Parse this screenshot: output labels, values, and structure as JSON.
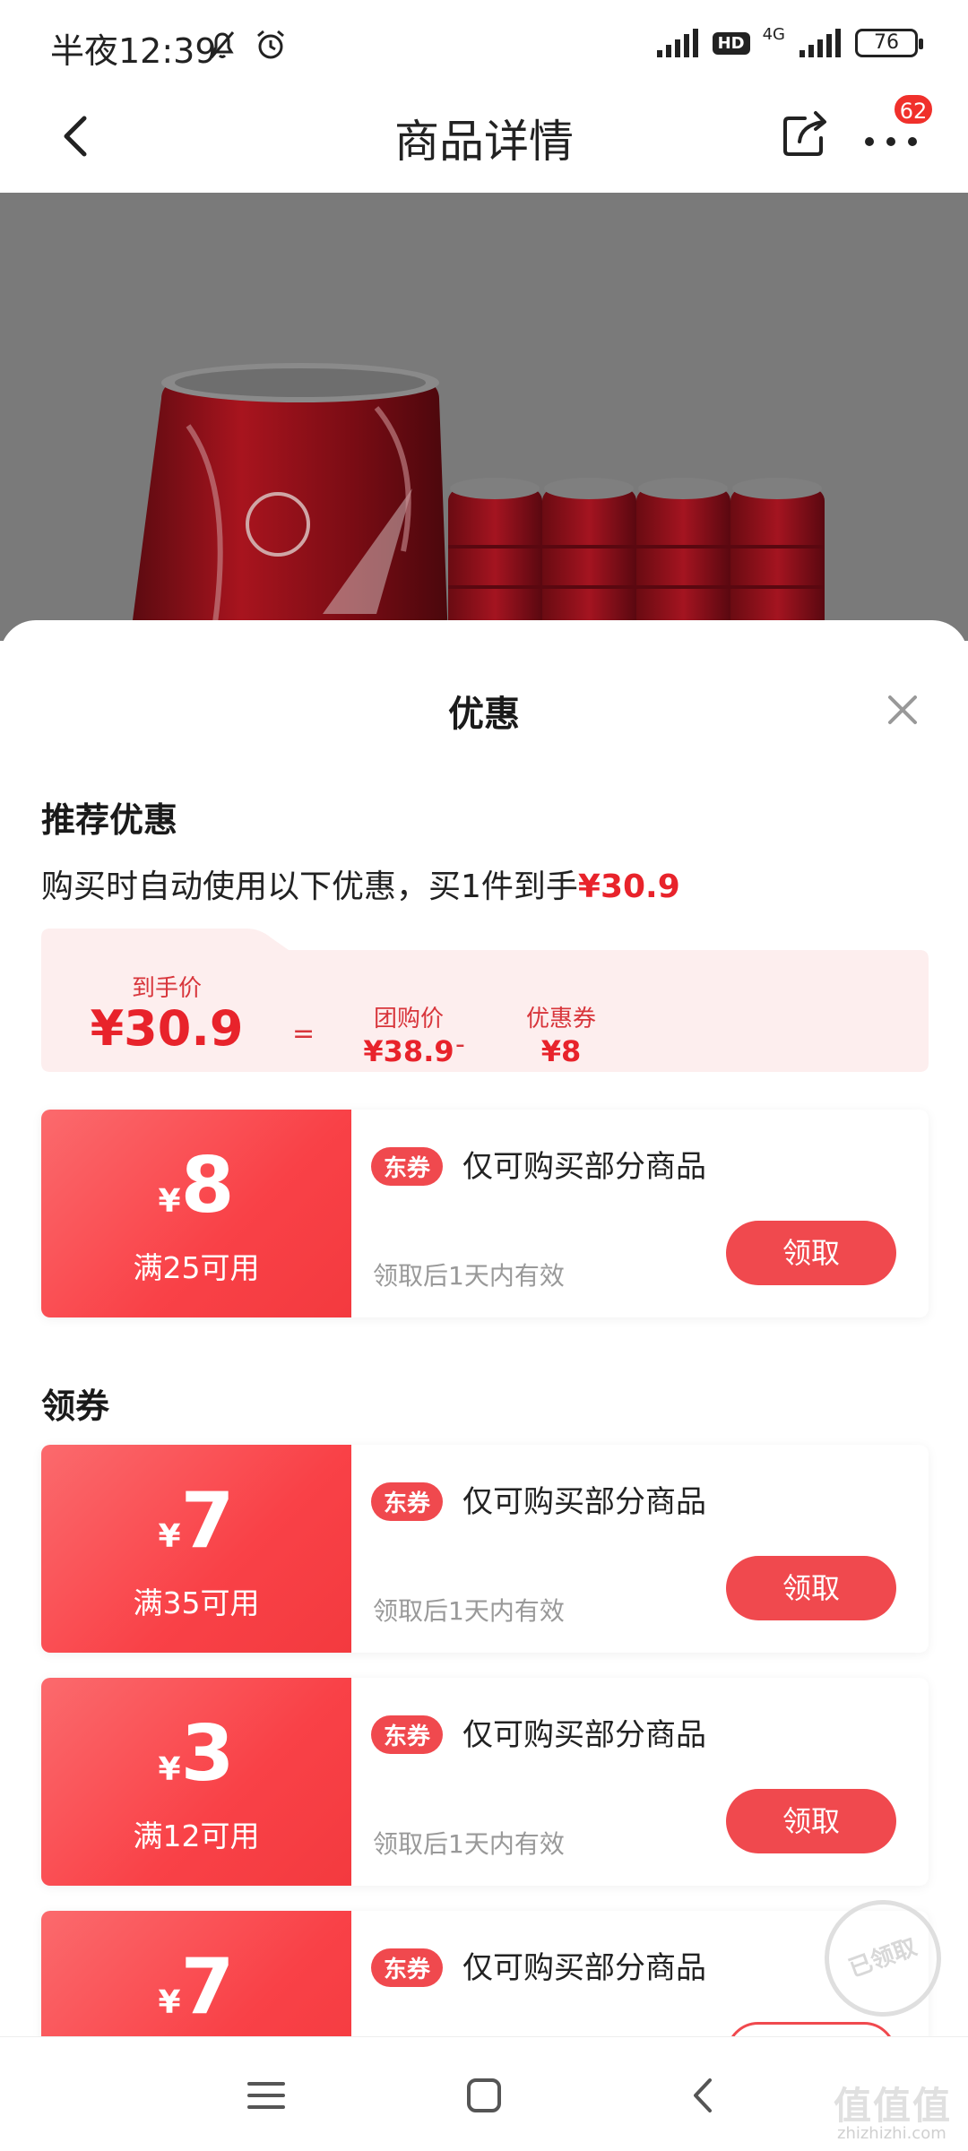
{
  "status_bar": {
    "time": "半夜12:39",
    "network": "4G",
    "hd": "HD",
    "battery": "76"
  },
  "nav": {
    "title": "商品详情",
    "more_badge": "62"
  },
  "sheet": {
    "title": "优惠",
    "recommended": {
      "section_title": "推荐优惠",
      "desc_prefix": "购买时自动使用以下优惠，买1件到手",
      "desc_price": "¥30.9",
      "final_label": "到手价",
      "final_value": "¥30.9",
      "eq": "=",
      "group_label": "团购价",
      "group_value": "¥38.9",
      "minus": "-",
      "coupon_label": "优惠券",
      "coupon_value": "¥8"
    },
    "recommended_coupon": {
      "yen": "¥",
      "amount": "8",
      "condition": "满25可用",
      "tag": "东券",
      "desc": "仅可购买部分商品",
      "validity": "领取后1天内有效",
      "button": "领取"
    },
    "collect_title": "领券",
    "coupons": [
      {
        "yen": "¥",
        "amount": "7",
        "condition": "满35可用",
        "tag": "东券",
        "desc": "仅可购买部分商品",
        "validity": "领取后1天内有效",
        "button": "领取"
      },
      {
        "yen": "¥",
        "amount": "3",
        "condition": "满12可用",
        "tag": "东券",
        "desc": "仅可购买部分商品",
        "validity": "领取后1天内有效",
        "button": "领取"
      },
      {
        "yen": "¥",
        "amount": "7",
        "tag": "东券",
        "desc": "仅可购买部分商品",
        "stamp": "已领取"
      }
    ]
  },
  "watermark": {
    "main": "值值值",
    "sub": "zhizhizhi.com"
  }
}
